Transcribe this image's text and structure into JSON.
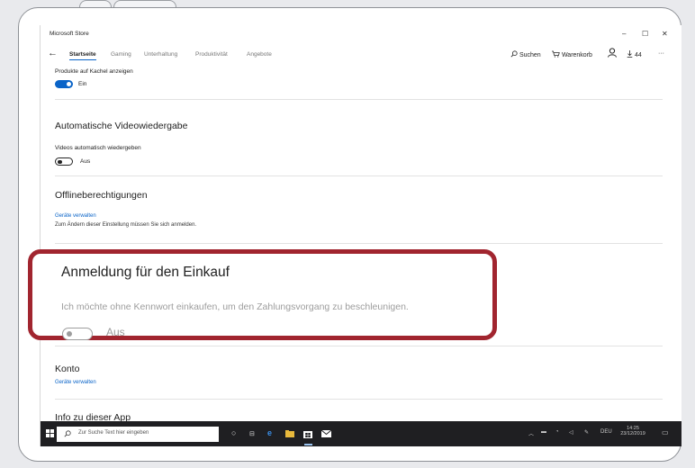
{
  "window": {
    "app_title": "Microsoft Store",
    "controls": [
      "–",
      "☐",
      "✕"
    ]
  },
  "navigation": {
    "back": "←",
    "tabs": [
      "Startseite",
      "Gaming",
      "Unterhaltung",
      "Produktivität",
      "Angebote"
    ],
    "active_tab": 0,
    "search": "Suchen",
    "cart": "Warenkorb",
    "downloads": "44",
    "more": "···"
  },
  "settings": {
    "tile_products": {
      "label": "Produkte auf Kachel anzeigen",
      "state": "Ein",
      "on": true
    },
    "autoplay": {
      "heading": "Automatische Videowiedergabe",
      "label": "Videos automatisch wiedergeben",
      "state": "Aus",
      "on": false
    },
    "offline": {
      "heading": "Offlineberechtigungen",
      "link": "Geräte verwalten",
      "hint": "Zum Ändern dieser Einstellung müssen Sie sich anmelden."
    },
    "purchase_signin": {
      "heading": "Anmeldung für den Einkauf",
      "description": "Ich möchte ohne Kennwort einkaufen, um den Zahlungsvorgang zu beschleunigen.",
      "state": "Aus",
      "on": false
    },
    "account": {
      "heading": "Konto",
      "link": "Geräte verwalten"
    },
    "about": {
      "heading": "Info zu dieser App"
    }
  },
  "taskbar": {
    "search_placeholder": "Zur Suche Text hier eingeben",
    "language": "DEU",
    "time": "14:25",
    "date": "23/12/2019"
  },
  "colors": {
    "accent": "#0a64c8",
    "highlight_border": "#a1252f",
    "taskbar": "#1f1f22"
  }
}
